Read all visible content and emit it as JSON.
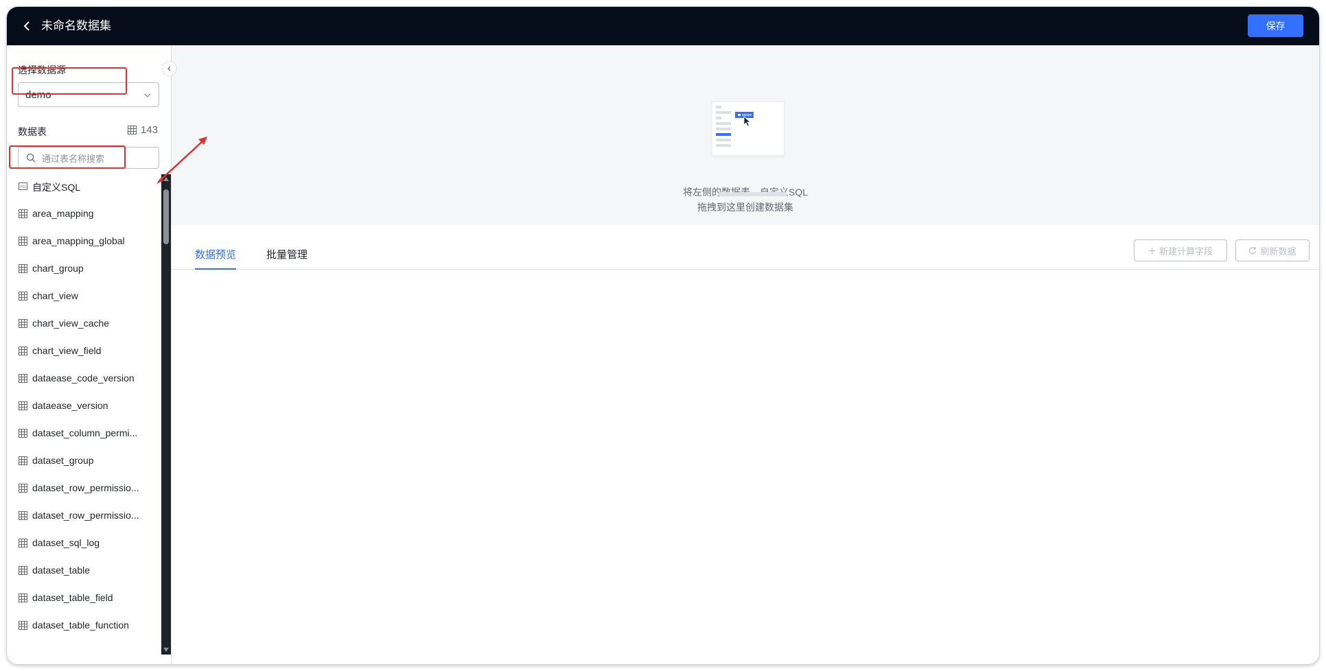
{
  "header": {
    "title": "未命名数据集",
    "save_label": "保存"
  },
  "sidebar": {
    "datasource_label": "选择数据源",
    "datasource_value": "demo",
    "tables_label": "数据表",
    "tables_count": "143",
    "search_placeholder": "通过表名称搜索",
    "custom_sql_label": "自定义SQL",
    "tables": [
      "area_mapping",
      "area_mapping_global",
      "chart_group",
      "chart_view",
      "chart_view_cache",
      "chart_view_field",
      "dataease_code_version",
      "dataease_version",
      "dataset_column_permi...",
      "dataset_group",
      "dataset_row_permissio...",
      "dataset_row_permissio...",
      "dataset_sql_log",
      "dataset_table",
      "dataset_table_field",
      "dataset_table_function"
    ]
  },
  "dropzone": {
    "line1": "将左侧的数据表、自定义SQL",
    "line2": "拖拽到这里创建数据集"
  },
  "tabs": [
    {
      "label": "数据预览",
      "active": true
    },
    {
      "label": "批量管理",
      "active": false
    }
  ],
  "toolbar": {
    "add_field_label": "新建计算字段",
    "refresh_label": "刷新数据"
  },
  "colors": {
    "accent": "#3370ff",
    "header_bg": "#050c1a",
    "annotation": "#e03131"
  }
}
